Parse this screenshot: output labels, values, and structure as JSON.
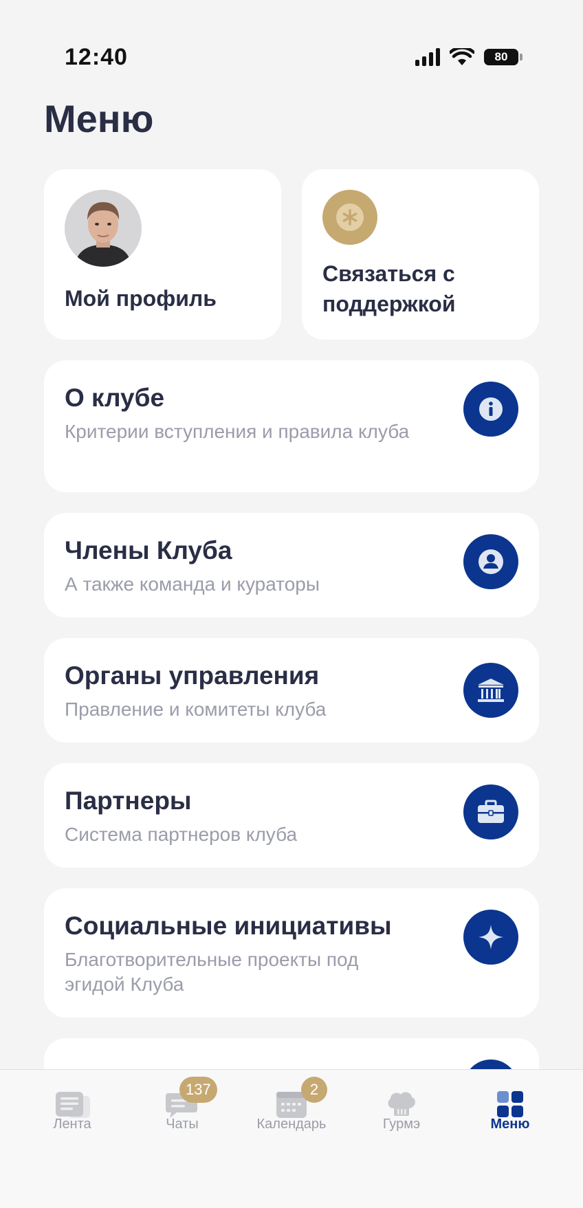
{
  "status_bar": {
    "time": "12:40",
    "battery": "80"
  },
  "page": {
    "title": "Меню"
  },
  "tiles": {
    "profile": {
      "label": "Мой профиль",
      "icon": "avatar"
    },
    "support": {
      "label": "Связаться с поддержкой",
      "icon": "asterisk-icon"
    }
  },
  "cards": [
    {
      "title": "О клубе",
      "subtitle": "Критерии вступления и правила клуба",
      "icon": "info-icon"
    },
    {
      "title": "Члены Клуба",
      "subtitle": "А также команда и кураторы",
      "icon": "user-icon"
    },
    {
      "title": "Органы управления",
      "subtitle": "Правление и комитеты клуба",
      "icon": "building-columns-icon"
    },
    {
      "title": "Партнеры",
      "subtitle": "Система партнеров клуба",
      "icon": "briefcase-icon"
    },
    {
      "title": "Социальные инициативы",
      "subtitle": "Благотворительные проекты под эгидой Клуба",
      "icon": "sparkle-icon"
    }
  ],
  "tabbar": {
    "items": [
      {
        "label": "Лента",
        "icon": "feed-icon"
      },
      {
        "label": "Чаты",
        "icon": "chat-icon",
        "badge": "137"
      },
      {
        "label": "Календарь",
        "icon": "calendar-icon",
        "badge": "2"
      },
      {
        "label": "Гурмэ",
        "icon": "chef-hat-icon"
      },
      {
        "label": "Меню",
        "icon": "menu-grid-icon",
        "active": true
      }
    ]
  },
  "colors": {
    "accent": "#0b358f",
    "gold": "#c6a871",
    "background": "#f4f4f5",
    "title": "#2a2e45",
    "subtitle": "#9a9caa"
  }
}
